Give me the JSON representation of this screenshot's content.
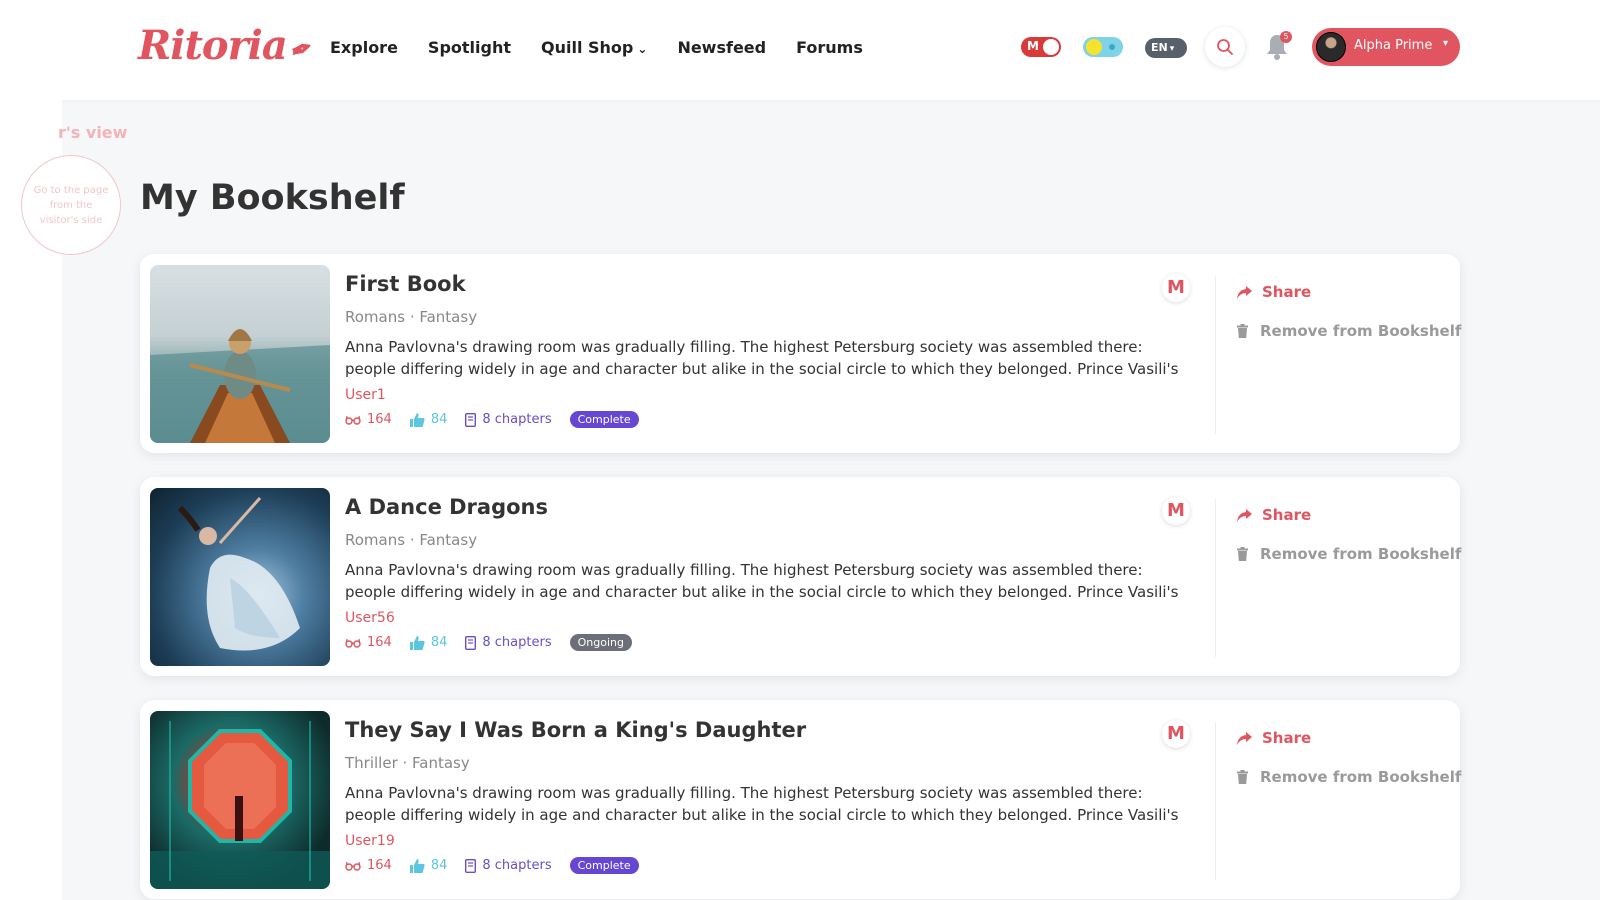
{
  "header": {
    "logo": "Ritoria",
    "nav": [
      {
        "label": "Explore"
      },
      {
        "label": "Spotlight"
      },
      {
        "label": "Quill Shop",
        "has_dropdown": true
      },
      {
        "label": "Newsfeed"
      },
      {
        "label": "Forums"
      }
    ],
    "mode_toggle_label": "M",
    "language": "EN",
    "notification_count": "5",
    "user_name": "Alpha Prime",
    "colors": {
      "accent": "#e0555f",
      "toggle_red": "#d83a3a",
      "theme_toggle": "#7fd3e6"
    }
  },
  "sidebar": {
    "visitor_view_label": "r's view",
    "visitor_circle_text": "Go to the page from the visitor's side"
  },
  "page": {
    "title": "My Bookshelf"
  },
  "books": [
    {
      "title": "First Book",
      "genres": "Romans · Fantasy",
      "description": "Anna Pavlovna's drawing room was gradually filling. The highest Petersburg society was assembled there: people differing widely in age and character but alike in the social circle to which they belonged. Prince Vasili's daughter, the...",
      "author": "User1",
      "views": "164",
      "likes": "84",
      "chapters": "8 chapters",
      "status": "Complete",
      "badge": "M",
      "share_label": "Share",
      "remove_label": "Remove from Bookshelf"
    },
    {
      "title": "A Dance Dragons",
      "genres": "Romans · Fantasy",
      "description": "Anna Pavlovna's drawing room was gradually filling. The highest Petersburg society was assembled there: people differing widely in age and character but alike in the social circle to which they belonged. Prince Vasili's daughter, the...",
      "author": "User56",
      "views": "164",
      "likes": "84",
      "chapters": "8 chapters",
      "status": "Ongoing",
      "badge": "M",
      "share_label": "Share",
      "remove_label": "Remove from Bookshelf"
    },
    {
      "title": "They Say I Was Born a King's Daughter",
      "genres": "Thriller · Fantasy",
      "description": "Anna Pavlovna's drawing room was gradually filling. The highest Petersburg society was assembled there: people differing widely in age and character but alike in the social circle to which they belonged. Prince Vasili's daughter, the...",
      "author": "User19",
      "views": "164",
      "likes": "84",
      "chapters": "8 chapters",
      "status": "Complete",
      "badge": "M",
      "share_label": "Share",
      "remove_label": "Remove from Bookshelf"
    }
  ]
}
